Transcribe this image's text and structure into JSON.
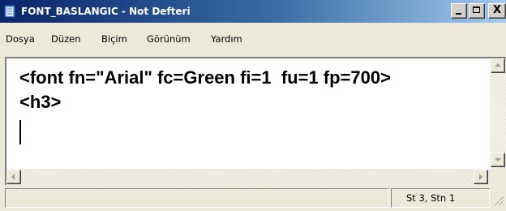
{
  "window": {
    "title": "FONT_BASLANGIC - Not Defteri",
    "app_icon": "notepad-icon",
    "controls": {
      "minimize_icon": "minimize-icon",
      "maximize_icon": "maximize-icon",
      "close_glyph": "X"
    }
  },
  "menu": {
    "items": [
      "Dosya",
      "Düzen",
      "Biçim",
      "Görünüm",
      "Yardım"
    ]
  },
  "editor": {
    "lines": [
      "<font fn=\"Arial\" fc=Green fi=1  fu=1 fp=700>",
      "<h3>",
      ""
    ],
    "caret_line": 3
  },
  "status": {
    "position": "St 3, Stn 1"
  },
  "colors": {
    "title_gradient_start": "#0a246a",
    "title_gradient_end": "#a6caf0",
    "chrome": "#ece9d8",
    "text": "#000000"
  }
}
